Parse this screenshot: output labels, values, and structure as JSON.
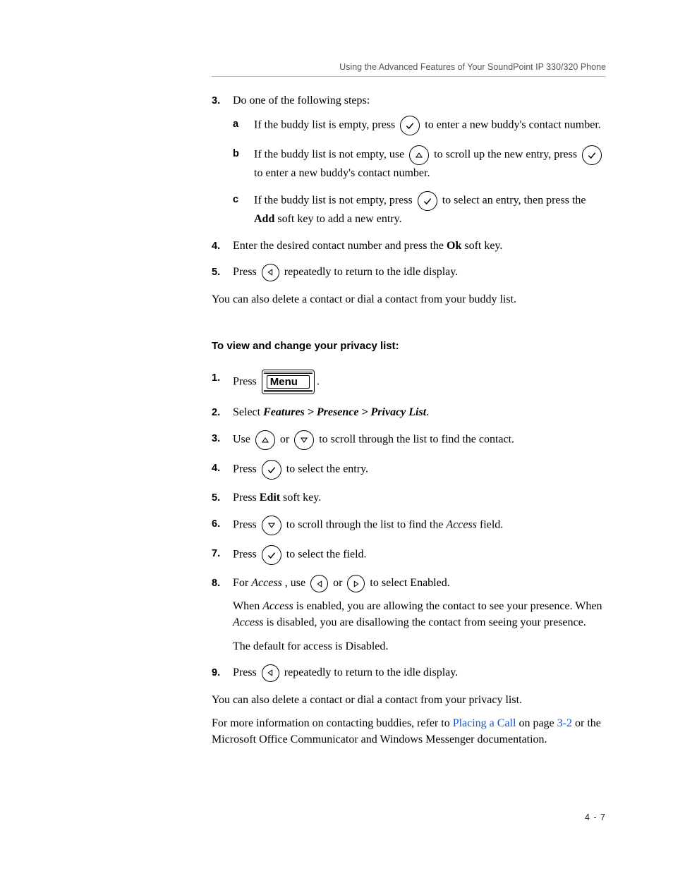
{
  "page": {
    "running_head": "Using the Advanced Features of Your SoundPoint IP 330/320 Phone",
    "footer": "4 - 7"
  },
  "icons": {
    "check": "check-icon",
    "up": "triangle-up-icon",
    "down": "triangle-down-icon",
    "left": "triangle-left-icon",
    "right": "triangle-right-icon",
    "menu_label": "Menu"
  },
  "steps_part1": {
    "s3": {
      "intro": "Do one of the following steps:",
      "a_pre": "If the buddy list is empty, press ",
      "a_post": " to enter a new buddy's contact number.",
      "b_pre": "If the buddy list is not empty, use ",
      "b_mid": " to scroll up the new entry, press ",
      "b_post": " to enter a new buddy's contact number.",
      "c_pre": "If the buddy list is not empty, press ",
      "c_mid": " to select an entry, then press the ",
      "c_add": "Add",
      "c_post": " soft key to add a new entry."
    },
    "s4_pre": "Enter the desired contact number and press the ",
    "s4_ok": "Ok",
    "s4_post": " soft key.",
    "s5_pre": "Press ",
    "s5_post": " repeatedly to return to the idle display.",
    "after": "You can also delete a contact or dial a contact from your buddy list."
  },
  "subhead": "To view and change your privacy list:",
  "steps_part2": {
    "s1_pre": "Press ",
    "s1_post": ".",
    "s2_pre": "Select ",
    "s2_path": "Features > Presence > Privacy List",
    "s2_post": ".",
    "s3_pre": "Use ",
    "s3_mid": " or ",
    "s3_post": " to scroll through the list to find the contact.",
    "s4_pre": "Press ",
    "s4_post": " to select the entry.",
    "s5_pre": "Press ",
    "s5_edit": "Edit",
    "s5_post": " soft key.",
    "s6_pre": "Press ",
    "s6_mid": " to scroll through the list to find the ",
    "s6_access": "Access",
    "s6_post": " field.",
    "s7_pre": "Press ",
    "s7_post": " to select the field.",
    "s8_pre": "For ",
    "s8_access": "Access",
    "s8_mid1": ", use ",
    "s8_mid2": " or ",
    "s8_post": " to select Enabled.",
    "s8_para1_pre": "When ",
    "s8_para1_access": "Access",
    "s8_para1_mid": " is enabled, you are allowing the contact to see your presence. When ",
    "s8_para1_access2": "Access",
    "s8_para1_post": " is disabled, you are disallowing the contact from seeing your presence.",
    "s8_para2": "The default for access is Disabled.",
    "s9_pre": "Press ",
    "s9_post": " repeatedly to return to the idle display."
  },
  "trailing": {
    "p1": "You can also delete a contact or dial a contact from your privacy list.",
    "p2_pre": "For more information on contacting buddies, refer to ",
    "p2_link1": "Placing a Call",
    "p2_mid": " on page ",
    "p2_link2": "3-2",
    "p2_post": " or the Microsoft Office Communicator and Windows Messenger documentation."
  }
}
